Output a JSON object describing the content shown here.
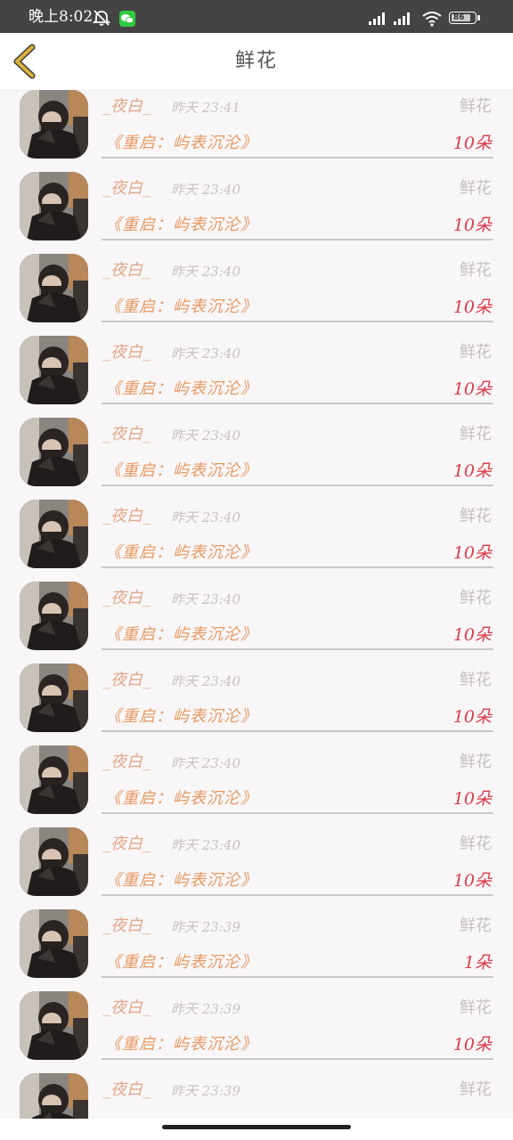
{
  "status_bar": {
    "time": "晚上8:02",
    "battery": "86",
    "icons": [
      "alarm-off-icon",
      "wechat-icon",
      "signal-icon",
      "signal-icon",
      "wifi-icon",
      "battery-icon"
    ]
  },
  "header": {
    "title": "鲜花",
    "back_icon": "chevron-left-icon",
    "accent_color": "#c9a227"
  },
  "records": [
    {
      "user": "_夜白_",
      "time": "昨天 23:41",
      "type": "鲜花",
      "book": "《重启：屿表沉沦》",
      "count": "10朵"
    },
    {
      "user": "_夜白_",
      "time": "昨天 23:40",
      "type": "鲜花",
      "book": "《重启：屿表沉沦》",
      "count": "10朵"
    },
    {
      "user": "_夜白_",
      "time": "昨天 23:40",
      "type": "鲜花",
      "book": "《重启：屿表沉沦》",
      "count": "10朵"
    },
    {
      "user": "_夜白_",
      "time": "昨天 23:40",
      "type": "鲜花",
      "book": "《重启：屿表沉沦》",
      "count": "10朵"
    },
    {
      "user": "_夜白_",
      "time": "昨天 23:40",
      "type": "鲜花",
      "book": "《重启：屿表沉沦》",
      "count": "10朵"
    },
    {
      "user": "_夜白_",
      "time": "昨天 23:40",
      "type": "鲜花",
      "book": "《重启：屿表沉沦》",
      "count": "10朵"
    },
    {
      "user": "_夜白_",
      "time": "昨天 23:40",
      "type": "鲜花",
      "book": "《重启：屿表沉沦》",
      "count": "10朵"
    },
    {
      "user": "_夜白_",
      "time": "昨天 23:40",
      "type": "鲜花",
      "book": "《重启：屿表沉沦》",
      "count": "10朵"
    },
    {
      "user": "_夜白_",
      "time": "昨天 23:40",
      "type": "鲜花",
      "book": "《重启：屿表沉沦》",
      "count": "10朵"
    },
    {
      "user": "_夜白_",
      "time": "昨天 23:40",
      "type": "鲜花",
      "book": "《重启：屿表沉沦》",
      "count": "10朵"
    },
    {
      "user": "_夜白_",
      "time": "昨天 23:39",
      "type": "鲜花",
      "book": "《重启：屿表沉沦》",
      "count": "1朵"
    },
    {
      "user": "_夜白_",
      "time": "昨天 23:39",
      "type": "鲜花",
      "book": "《重启：屿表沉沦》",
      "count": "10朵"
    },
    {
      "user": "_夜白_",
      "time": "昨天 23:39",
      "type": "鲜花",
      "book": "",
      "count": ""
    }
  ],
  "colors": {
    "user_name": "#e3a98b",
    "book_title": "#e79a64",
    "gift_count": "#dc3b4a",
    "muted_text": "#c6c0c0",
    "background": "#f8f6f7"
  }
}
